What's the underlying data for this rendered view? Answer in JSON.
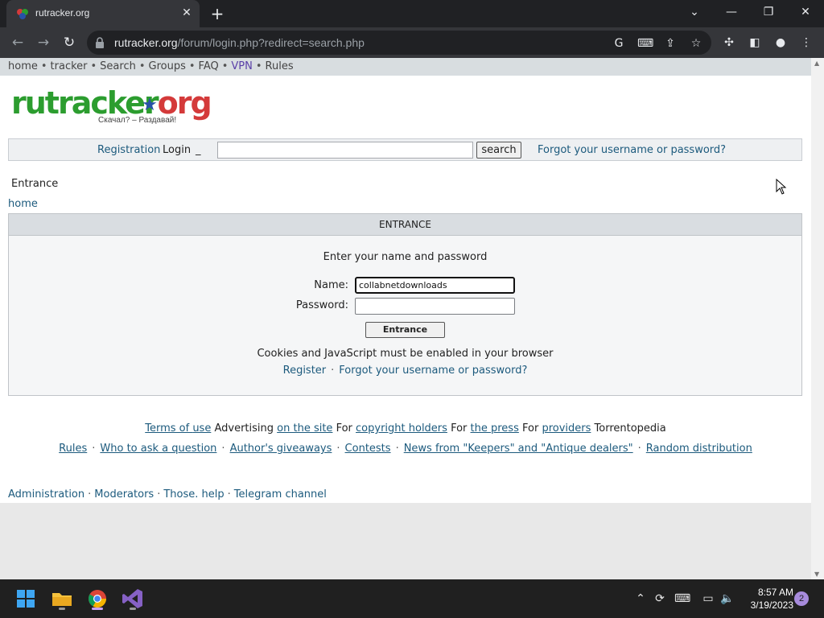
{
  "browser": {
    "tab_title": "rutracker.org",
    "tab_close": "✕",
    "new_tab": "+",
    "url_host": "rutracker.org",
    "url_path": "/forum/login.php?redirect=search.php"
  },
  "topnav": {
    "items": [
      "home",
      "tracker",
      "Search",
      "Groups",
      "FAQ",
      "VPN",
      "Rules"
    ]
  },
  "logo": {
    "part1": "ru",
    "part2": "tracker",
    "part3": "org",
    "tagline": "Скачал? – Раздавай!"
  },
  "loginbar": {
    "registration": "Registration",
    "login": "Login",
    "underscore": "_",
    "search_button": "search",
    "forgot": "Forgot your username or password?"
  },
  "crumbs": {
    "title": "Entrance",
    "home": "home"
  },
  "panel": {
    "header": "ENTRANCE",
    "prompt": "Enter your name and password",
    "name_label": "Name:",
    "name_value": "collabnetdownloads",
    "password_label": "Password:",
    "submit": "Entrance",
    "note": "Cookies and JavaScript must be enabled in your browser",
    "register": "Register",
    "forgot": "Forgot your username or password?"
  },
  "footer": {
    "row1": {
      "terms": "Terms of ",
      "use": "use",
      "advertising": "Advertising",
      "on_site": "on the site",
      "for1": "For",
      "copyright": "copyright holders",
      "for2": "For",
      "press": "the press",
      "for3": "For",
      "providers": "providers",
      "torrentopedia": "Torrentopedia"
    },
    "row2": [
      "Rules",
      "Who to ask a question",
      "Author's giveaways",
      "Contests",
      "News from \"Keepers\" and \"Antique dealers\"",
      "Random distribution"
    ],
    "row3": [
      "Administration",
      "Moderators",
      "Those. help",
      "Telegram channel"
    ]
  },
  "taskbar": {
    "time": "8:57 AM",
    "date": "3/19/2023",
    "notifications": "2"
  }
}
